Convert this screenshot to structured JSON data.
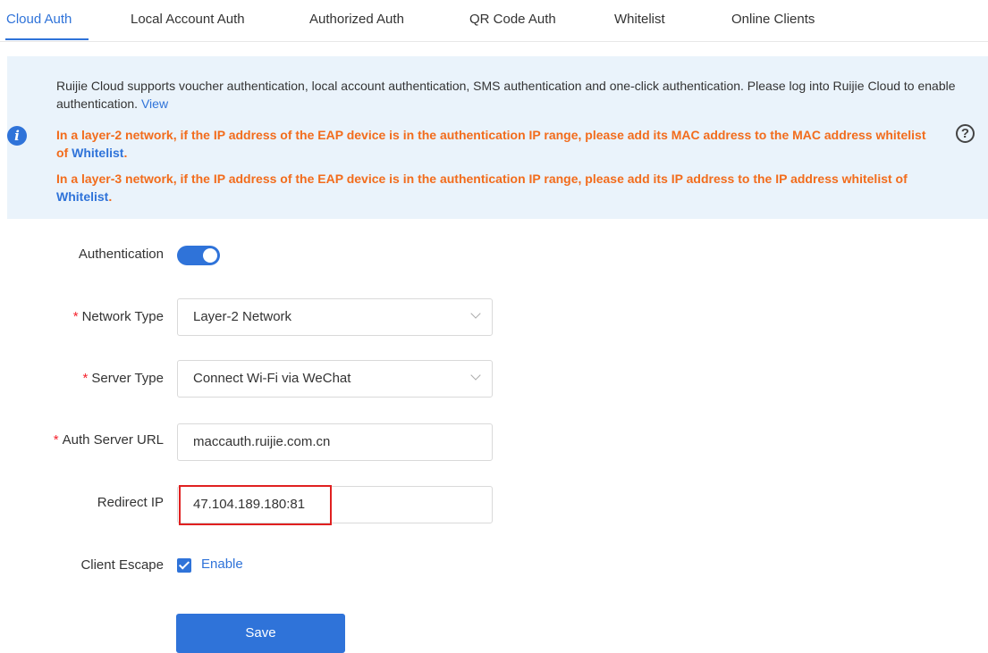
{
  "tabs": [
    {
      "label": "Cloud Auth"
    },
    {
      "label": "Local Account Auth"
    },
    {
      "label": "Authorized Auth"
    },
    {
      "label": "QR Code Auth"
    },
    {
      "label": "Whitelist"
    },
    {
      "label": "Online Clients"
    }
  ],
  "active_tab": "Cloud Auth",
  "notice": {
    "main_text": "Ruijie Cloud supports voucher authentication, local account authentication, SMS authentication and one-click authentication. Please log into Ruijie Cloud to enable authentication.",
    "view_link": "View",
    "warn1_text": "In a layer-2 network, if the IP address of the EAP device is in the authentication IP range, please add its MAC address to the MAC address whitelist of",
    "warn2_text": "In a layer-3 network, if the IP address of the EAP device is in the authentication IP range, please add its IP address to the IP address whitelist of",
    "whitelist_link": "Whitelist",
    "period": ".",
    "info_icon": "info-icon",
    "help_icon": "help-icon"
  },
  "form": {
    "authentication": {
      "label": "Authentication",
      "enabled": true
    },
    "network_type": {
      "label": "Network Type",
      "value": "Layer-2 Network"
    },
    "server_type": {
      "label": "Server Type",
      "value": "Connect Wi-Fi via WeChat"
    },
    "auth_server_url": {
      "label": "Auth Server URL",
      "value": "maccauth.ruijie.com.cn"
    },
    "redirect_ip": {
      "label": "Redirect IP",
      "value": "47.104.189.180:81"
    },
    "client_escape": {
      "label": "Client Escape",
      "checkbox_label": "Enable",
      "checked": true
    },
    "required_mark": "*",
    "save_label": "Save"
  },
  "colors": {
    "accent": "#2f73d9",
    "warning": "#f26c1c",
    "required": "#f5222d",
    "highlight": "#e02020",
    "notice_bg": "#eaf3fb"
  }
}
